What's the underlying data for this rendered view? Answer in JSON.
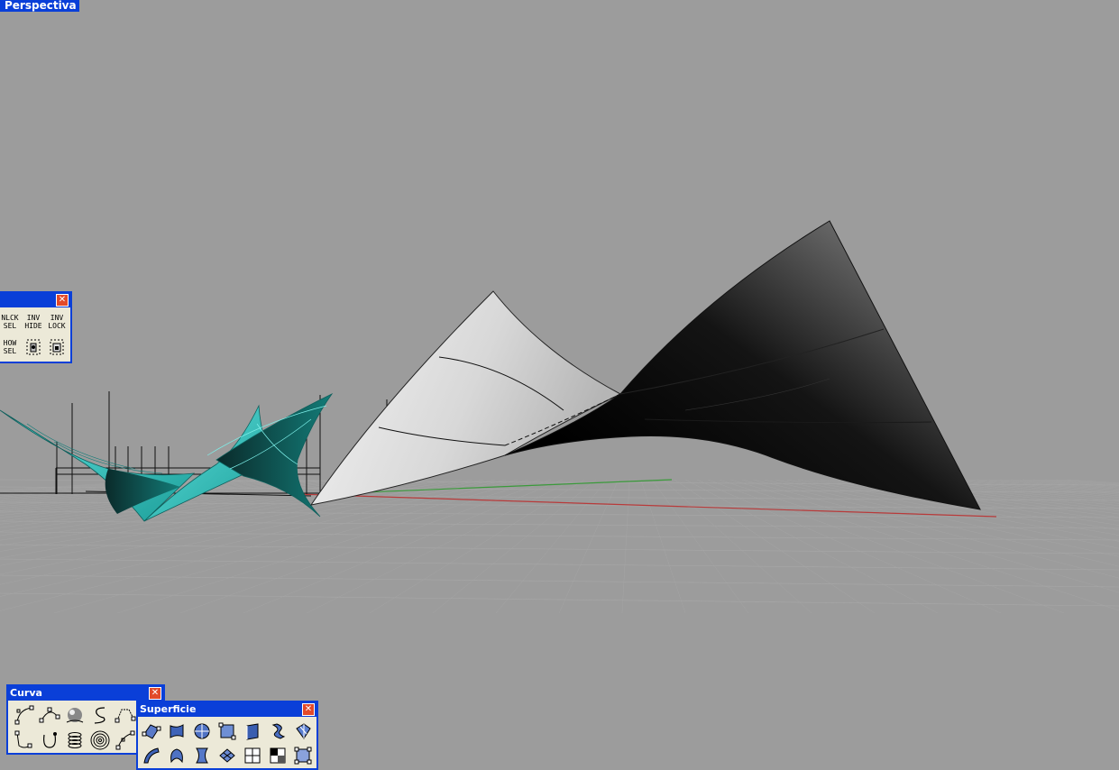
{
  "viewport": {
    "title": "Perspectiva"
  },
  "toolbars": {
    "visibility": {
      "close_glyph": "✕",
      "buttons": [
        {
          "text": "NLCK\nSEL",
          "icon": "unlock-selected-icon"
        },
        {
          "text": "INV\nHIDE",
          "icon": "invert-hide-icon"
        },
        {
          "text": "INV\nLOCK",
          "icon": "invert-lock-icon"
        },
        {
          "text": "HOW\nSEL",
          "icon": "show-selected-icon"
        },
        {
          "text": "",
          "icon": "hide-points-icon"
        },
        {
          "text": "",
          "icon": "lock-points-icon"
        }
      ]
    },
    "curva": {
      "title": "Curva",
      "close_glyph": "✕",
      "buttons": [
        {
          "icon": "control-point-curve-icon"
        },
        {
          "icon": "interpolate-curve-icon"
        },
        {
          "icon": "sphere-curve-icon"
        },
        {
          "icon": "freeform-curve-icon"
        },
        {
          "icon": "polyline-curve-icon"
        },
        {
          "icon": "sketch-curve-icon"
        },
        {
          "icon": "arc-curve-icon"
        },
        {
          "icon": "helix-icon"
        },
        {
          "icon": "spiral-icon"
        },
        {
          "icon": "curve-points-icon"
        }
      ]
    },
    "superficie": {
      "title": "Superficie",
      "close_glyph": "✕",
      "buttons": [
        {
          "icon": "surface-from-points-icon"
        },
        {
          "icon": "surface-from-edges-icon"
        },
        {
          "icon": "patch-surface-icon"
        },
        {
          "icon": "plane-surface-icon"
        },
        {
          "icon": "extrude-surface-icon"
        },
        {
          "icon": "loft-surface-icon"
        },
        {
          "icon": "sweep-surface-icon"
        },
        {
          "icon": "rail-revolve-icon"
        },
        {
          "icon": "revolve-surface-icon"
        },
        {
          "icon": "network-surface-icon"
        },
        {
          "icon": "blend-surface-icon"
        },
        {
          "icon": "grid-surface-icon"
        },
        {
          "icon": "quad-surface-icon"
        },
        {
          "icon": "point-grid-icon"
        }
      ]
    }
  },
  "colors": {
    "background": "#9c9c9c",
    "title_blue": "#0a3fd8",
    "toolbar_face": "#ece9d8",
    "axis_x": "#b83a3a",
    "axis_y": "#3a9a3a",
    "cyan_surface": "#2bbfb8"
  }
}
